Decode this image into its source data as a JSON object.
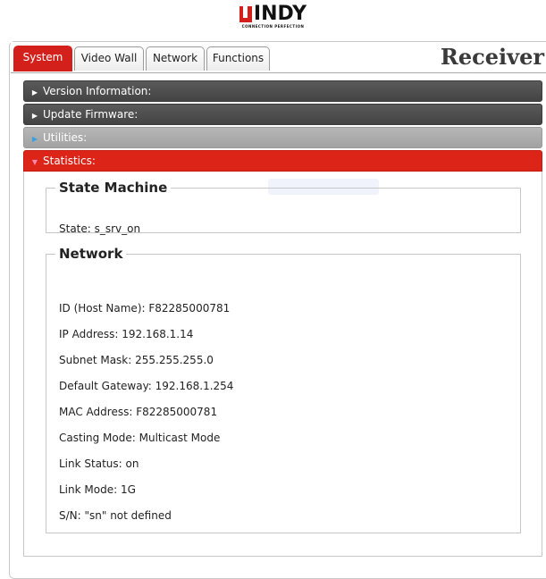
{
  "logo": {
    "text": "INDY",
    "tagline": "CONNECTION PERFECTION"
  },
  "tabs": [
    {
      "label": "System",
      "active": true
    },
    {
      "label": "Video Wall",
      "active": false
    },
    {
      "label": "Network",
      "active": false
    },
    {
      "label": "Functions",
      "active": false
    }
  ],
  "device_role": "Receiver",
  "accordion": {
    "version": "Version Information:",
    "firmware": "Update Firmware:",
    "utilities": "Utilities:",
    "statistics": "Statistics:"
  },
  "state_machine": {
    "title": "State Machine",
    "state": "State: s_srv_on"
  },
  "network": {
    "title": "Network",
    "lines": [
      "ID (Host Name): F82285000781",
      "IP Address: 192.168.1.14",
      "Subnet Mask: 255.255.255.0",
      "Default Gateway: 192.168.1.254",
      "MAC Address: F82285000781",
      "Casting Mode: Multicast Mode",
      "Link Status: on",
      "Link Mode: 1G",
      "S/N: \"sn\" not defined"
    ]
  },
  "colors": {
    "accent": "#d4201a",
    "dark_header": "#4a4a4a",
    "grey_header": "#a8a8a8"
  },
  "icons": {
    "collapsed": "triangle-right-icon",
    "expanded": "triangle-down-icon"
  }
}
